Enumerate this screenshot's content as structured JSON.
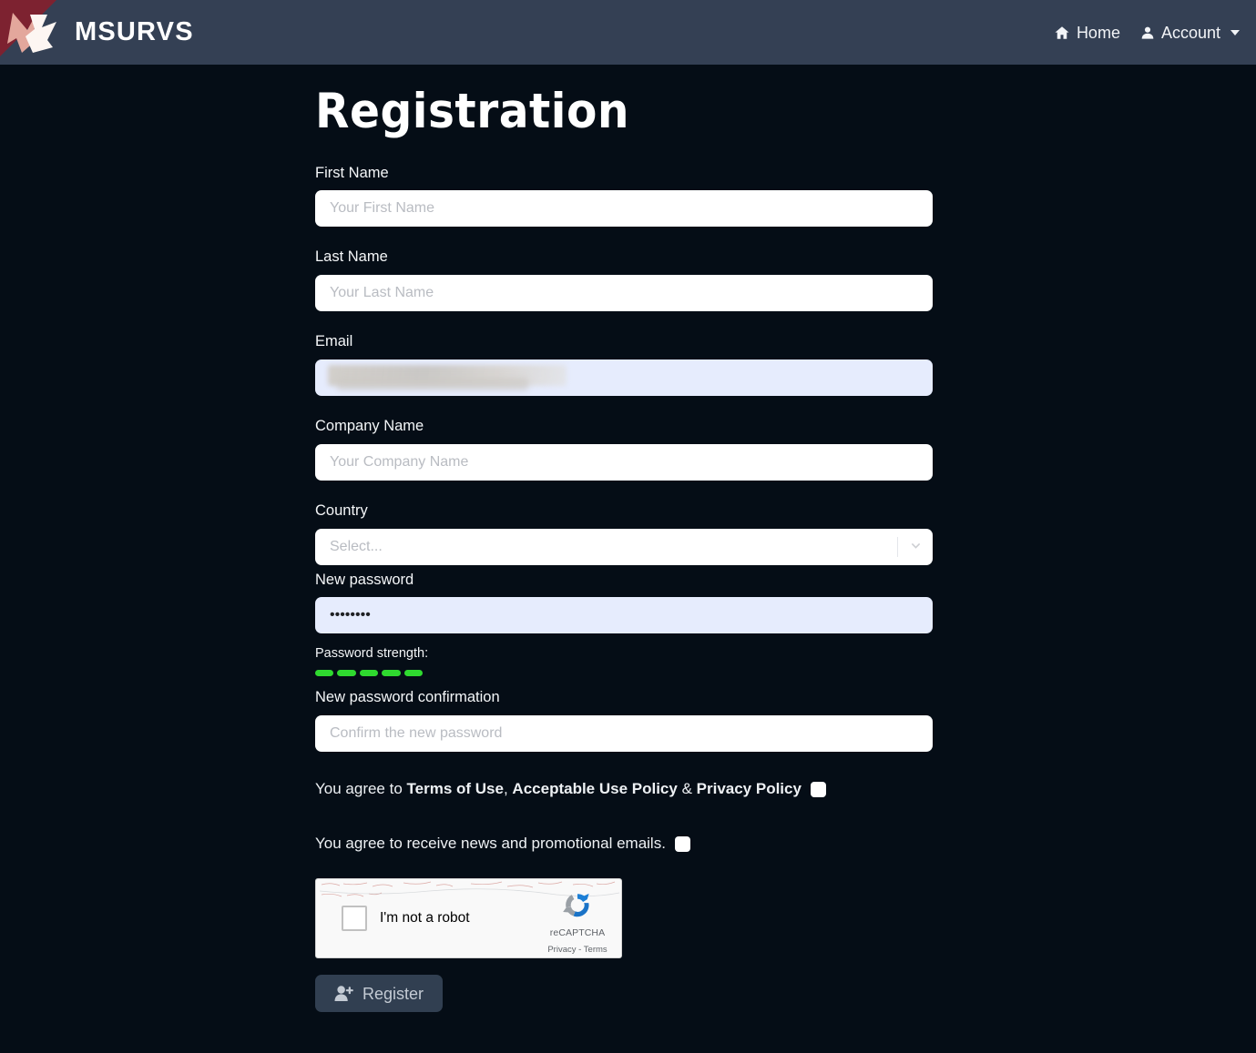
{
  "header": {
    "brand_name": "MSURVS",
    "logo_icon": "msurvs-arrow-logo",
    "nav": [
      {
        "label": "Home",
        "icon": "home-icon"
      },
      {
        "label": "Account",
        "icon": "user-icon",
        "has_caret": true
      }
    ]
  },
  "page": {
    "title": "Registration"
  },
  "form": {
    "first_name": {
      "label": "First Name",
      "placeholder": "Your First Name",
      "value": ""
    },
    "last_name": {
      "label": "Last Name",
      "placeholder": "Your Last Name",
      "value": ""
    },
    "email": {
      "label": "Email",
      "placeholder": "",
      "value": "",
      "redacted": true
    },
    "company_name": {
      "label": "Company Name",
      "placeholder": "Your Company Name",
      "value": ""
    },
    "country": {
      "label": "Country",
      "placeholder": "Select...",
      "value": "Select...",
      "indicator_icon": "chevron-down-icon"
    },
    "new_password": {
      "label": "New password",
      "value": "••••••••",
      "char_count": 8
    },
    "password_strength": {
      "label": "Password strength:",
      "segments_total": 5,
      "segments_filled": 5,
      "color": "#2fd92f"
    },
    "password_confirmation": {
      "label": "New password confirmation",
      "placeholder": "Confirm the new password",
      "value": ""
    }
  },
  "agreements": [
    {
      "prefix": "You agree to ",
      "links": [
        "Terms of Use",
        "Acceptable Use Policy",
        "Privacy Policy"
      ],
      "sep1": ", ",
      "sep2": " & ",
      "checked": false
    },
    {
      "text": "You agree to receive news and promotional emails.",
      "checked": false
    }
  ],
  "recaptcha": {
    "label": "I'm not a robot",
    "brand": "reCAPTCHA",
    "privacy": "Privacy",
    "separator": " - ",
    "terms": "Terms",
    "checked": false,
    "logo_icon": "recaptcha-logo-icon"
  },
  "submit": {
    "label": "Register",
    "icon": "user-plus-icon",
    "disabled": true
  },
  "colors": {
    "header_bg": "#344054",
    "page_bg": "#050d16",
    "input_bg": "#ffffff",
    "autofill_bg": "#e6ecfd",
    "strength_green": "#2fd92f",
    "button_bg": "#313f51",
    "logo_red": "#7d2230",
    "logo_salmon": "#e0a096"
  }
}
